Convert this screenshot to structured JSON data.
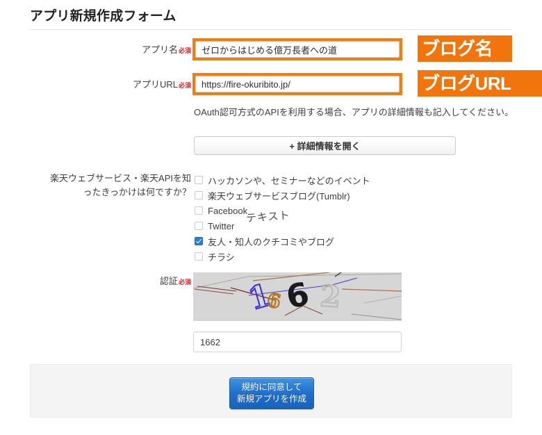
{
  "page": {
    "title": "アプリ新規作成フォーム"
  },
  "form": {
    "app_name": {
      "label": "アプリ名",
      "required_mark": "必須",
      "value": "ゼロからはじめる億万長者への道",
      "placeholder": ""
    },
    "app_url": {
      "label": "アプリURL",
      "required_mark": "必須",
      "value": "https://fire-okuribito.jp/",
      "placeholder": ""
    },
    "oauth_help": "OAuth認可方式のAPIを利用する場合、アプリの詳細情報も記入してください。",
    "detail_toggle_label": "+ 詳細情報を開く",
    "source_question": {
      "label_line1": "楽天ウェブサービス・楽天APIを知",
      "label_line2": "ったきっかけは何ですか？",
      "options": [
        {
          "label": "ハッカソンや、セミナーなどのイベント",
          "checked": false
        },
        {
          "label": "楽天ウェブサービスブログ(Tumblr)",
          "checked": false
        },
        {
          "label": "Facebook",
          "checked": false
        },
        {
          "label": "Twitter",
          "checked": false
        },
        {
          "label": "友人・知人のクチコミやブログ",
          "checked": true
        },
        {
          "label": "チラシ",
          "checked": false
        }
      ]
    },
    "captcha": {
      "label": "認証",
      "required_mark": "必須",
      "image_digits": [
        "1",
        "6",
        "6",
        "2"
      ],
      "digit_colors": [
        "#3b2fd4",
        "#b5761c",
        "#1a1a1a",
        "#b9b9b9"
      ],
      "value": "1662",
      "placeholder": ""
    },
    "submit": {
      "line1": "規約に同意して",
      "line2": "新規アプリを作成"
    }
  },
  "annotations": {
    "blog_name_callout": "ブログ名",
    "blog_url_callout": "ブログURL",
    "text_note": "テキスト",
    "callout_color": "#f2740d"
  }
}
